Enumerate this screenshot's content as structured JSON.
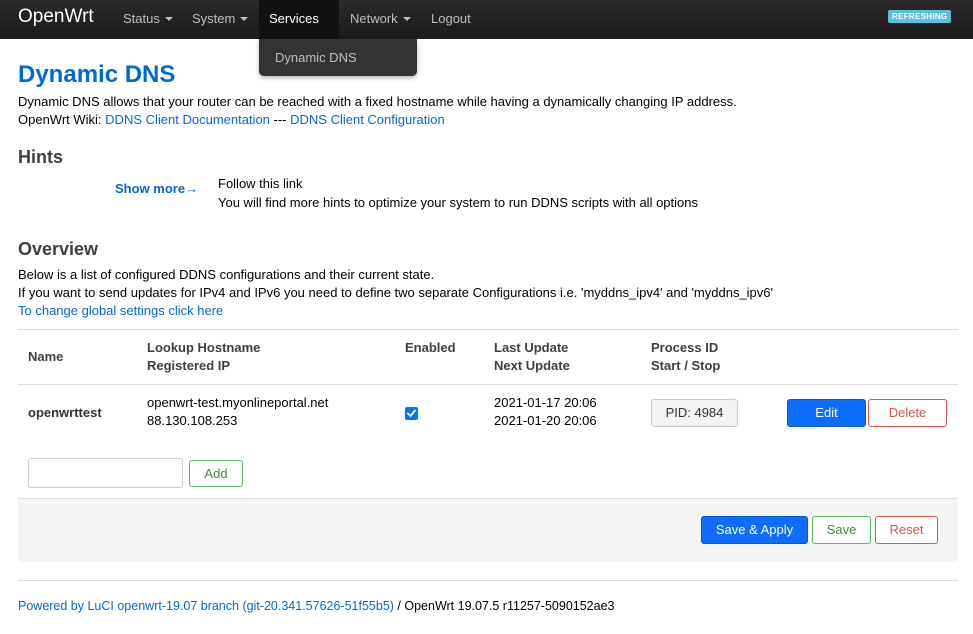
{
  "header": {
    "brand": "OpenWrt",
    "nav": [
      {
        "label": "Status",
        "dropdown": true
      },
      {
        "label": "System",
        "dropdown": true
      },
      {
        "label": "Services",
        "dropdown": true,
        "active": true
      },
      {
        "label": "Network",
        "dropdown": true
      },
      {
        "label": "Logout",
        "dropdown": false
      }
    ],
    "status_badge": "REFRESHING",
    "services_menu": [
      "Dynamic DNS"
    ]
  },
  "page": {
    "title": "Dynamic DNS",
    "description": "Dynamic DNS allows that your router can be reached with a fixed hostname while having a dynamically changing IP address.",
    "wiki_prefix": "OpenWrt Wiki: ",
    "wiki_link1": "DDNS Client Documentation",
    "wiki_sep": " --- ",
    "wiki_link2": "DDNS Client Configuration"
  },
  "hints": {
    "title": "Hints",
    "show_more": "Show more→",
    "line1": "Follow this link",
    "line2": "You will find more hints to optimize your system to run DDNS scripts with all options"
  },
  "overview": {
    "title": "Overview",
    "line1": "Below is a list of configured DDNS configurations and their current state.",
    "line2": "If you want to send updates for IPv4 and IPv6 you need to define two separate Configurations i.e. 'myddns_ipv4' and 'myddns_ipv6'",
    "global_link": "To change global settings click here"
  },
  "table": {
    "headers": {
      "name": "Name",
      "lookup": "Lookup Hostname",
      "registered": "Registered IP",
      "enabled": "Enabled",
      "last_update": "Last Update",
      "next_update": "Next Update",
      "process_id": "Process ID",
      "start_stop": "Start / Stop"
    },
    "rows": [
      {
        "name": "openwrttest",
        "hostname": "openwrt-test.myonlineportal.net",
        "ip": "88.130.108.253",
        "enabled": true,
        "last_update": "2021-01-17 20:06",
        "next_update": "2021-01-20 20:06",
        "pid_label": "PID: 4984",
        "edit_label": "Edit",
        "delete_label": "Delete"
      }
    ]
  },
  "add": {
    "input_value": "",
    "button_label": "Add"
  },
  "actions": {
    "save_apply": "Save & Apply",
    "save": "Save",
    "reset": "Reset"
  },
  "footer": {
    "link": "Powered by LuCI openwrt-19.07 branch (git-20.341.57626-51f55b5)",
    "suffix": " / OpenWrt 19.07.5 r11257-5090152ae3"
  },
  "colors": {
    "link": "#0069d6",
    "primary": "#0d6efd",
    "danger": "#d9534f",
    "success": "#5cb85c",
    "badge": "#5bc0de"
  }
}
